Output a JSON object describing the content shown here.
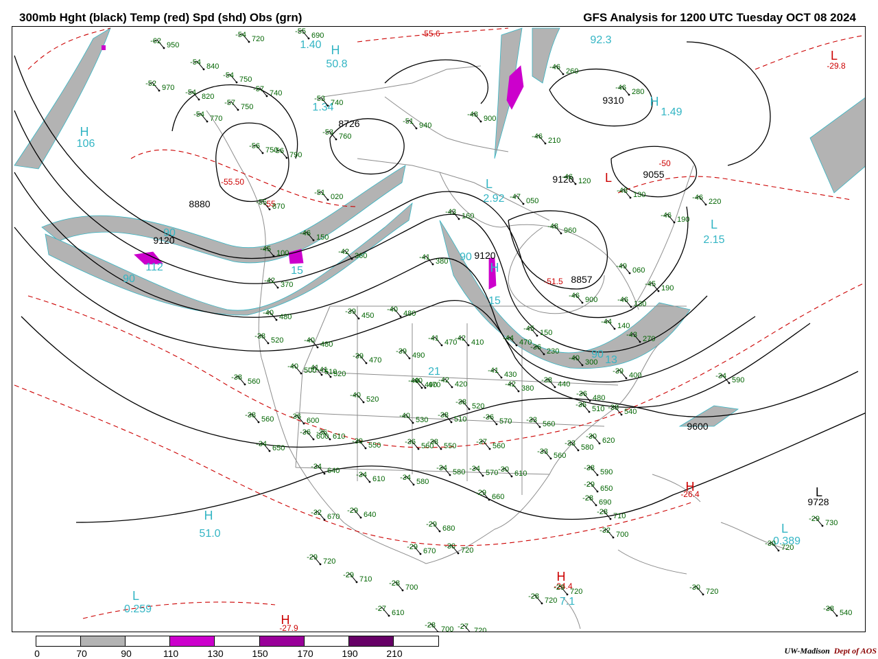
{
  "title_left": "300mb Hght (black) Temp (red) Spd (shd) Obs (grn)",
  "title_right": "GFS Analysis for 1200 UTC Tuesday  OCT 08 2024",
  "credit": {
    "org": "UW-Madison",
    "dept": "Dept of AOS"
  },
  "colors": {
    "height_contour": "#000000",
    "temperature_contour": "#cc0000",
    "obs_text": "#006400",
    "speed_label": "#33b5c4",
    "speed_70_90": "#b3b3b3",
    "speed_110_130": "#cc00cc",
    "speed_150_170": "#990099",
    "speed_190_210": "#660066",
    "map_lines": "#888888"
  },
  "legend": {
    "ticks": [
      "0",
      "70",
      "90",
      "110",
      "130",
      "150",
      "170",
      "190",
      "210"
    ],
    "segments": [
      "#ffffff",
      "#b3b3b3",
      "#ffffff",
      "#cc00cc",
      "#ffffff",
      "#990099",
      "#ffffff",
      "#660066",
      "#ffffff"
    ]
  },
  "height_labels": [
    "8726",
    "8880",
    "9120",
    "9120",
    "8857",
    "9055",
    "9120",
    "9310",
    "9600",
    "9728"
  ],
  "temp_labels": [
    "-55.6",
    "-55.50",
    "-55",
    "-51.5",
    "-50",
    "-29.8",
    "-26.4",
    "-27.9",
    "-24.4"
  ],
  "highlow_labels": [
    "H",
    "H",
    "H",
    "L",
    "L",
    "L",
    "L",
    "L",
    "H",
    "H",
    "H",
    "H",
    "H",
    "L",
    "L"
  ],
  "speed_labels": [
    "92.3",
    "50.8",
    "1.40",
    "1.34",
    "106",
    "2.92",
    "1.49",
    "2.15",
    "90",
    "112",
    "90",
    "90",
    "15",
    "15",
    "90",
    "51.0",
    "0.259",
    "0.389",
    "7.1",
    "21",
    "13"
  ],
  "observations": [
    "-62 950",
    "-54 840",
    "-52 970",
    "-54 820",
    "-54 770",
    "-54 750",
    "-57 740",
    "-57 750",
    "-53 740",
    "-55 690",
    "-54 720",
    "-56 750",
    "-56 790",
    "-55 870",
    "-51 020",
    "-46 150",
    "-45 100",
    "-42 370",
    "-42 360",
    "-41 380",
    "-43 160",
    "-47 050",
    "-48 960",
    "-51 940",
    "-53 760",
    "-48 900",
    "-46 210",
    "-46 260",
    "-46 280",
    "-46 120",
    "-48 130",
    "-46 220",
    "-46 190",
    "-49 060",
    "-45 190",
    "-46 900",
    "-46 130",
    "-44 140",
    "-43 270",
    "-39 400",
    "-34 590",
    "-40 480",
    "-39 450",
    "-40 480",
    "-41 470",
    "-42 410",
    "-44 470",
    "-45 150",
    "-36 230",
    "-40 300",
    "-38 520",
    "-40 480",
    "-40 500",
    "-39 470",
    "-39 490",
    "-40 470",
    "-42 420",
    "-41 430",
    "-42 380",
    "-38 440",
    "-36 480",
    "-36 510",
    "-38 540",
    "-38 560",
    "-36 600",
    "-36 610",
    "-39 550",
    "-40 520",
    "-40 530",
    "-38 510",
    "-38 520",
    "-36 570",
    "-36 560",
    "-38 550",
    "-37 560",
    "-33 560",
    "-33 560",
    "-33 580",
    "-30 620",
    "-38 590",
    "-34 650",
    "-34 640",
    "-34 610",
    "-34 580",
    "-34 580",
    "-34 570",
    "-30 610",
    "-29 660",
    "-29 650",
    "-28 690",
    "-28 710",
    "-32 700",
    "-32 670",
    "-29 640",
    "-29 680",
    "-29 670",
    "-30 720",
    "-29 720",
    "-29 710",
    "-28 700",
    "-27 610",
    "-28 700",
    "-27 720",
    "-28 720",
    "-29 720",
    "-30 720",
    "-29 730",
    "-30 720",
    "-38 540",
    "-38 560",
    "-41 520",
    "-41 510",
    "-40 490",
    "-36 600"
  ]
}
